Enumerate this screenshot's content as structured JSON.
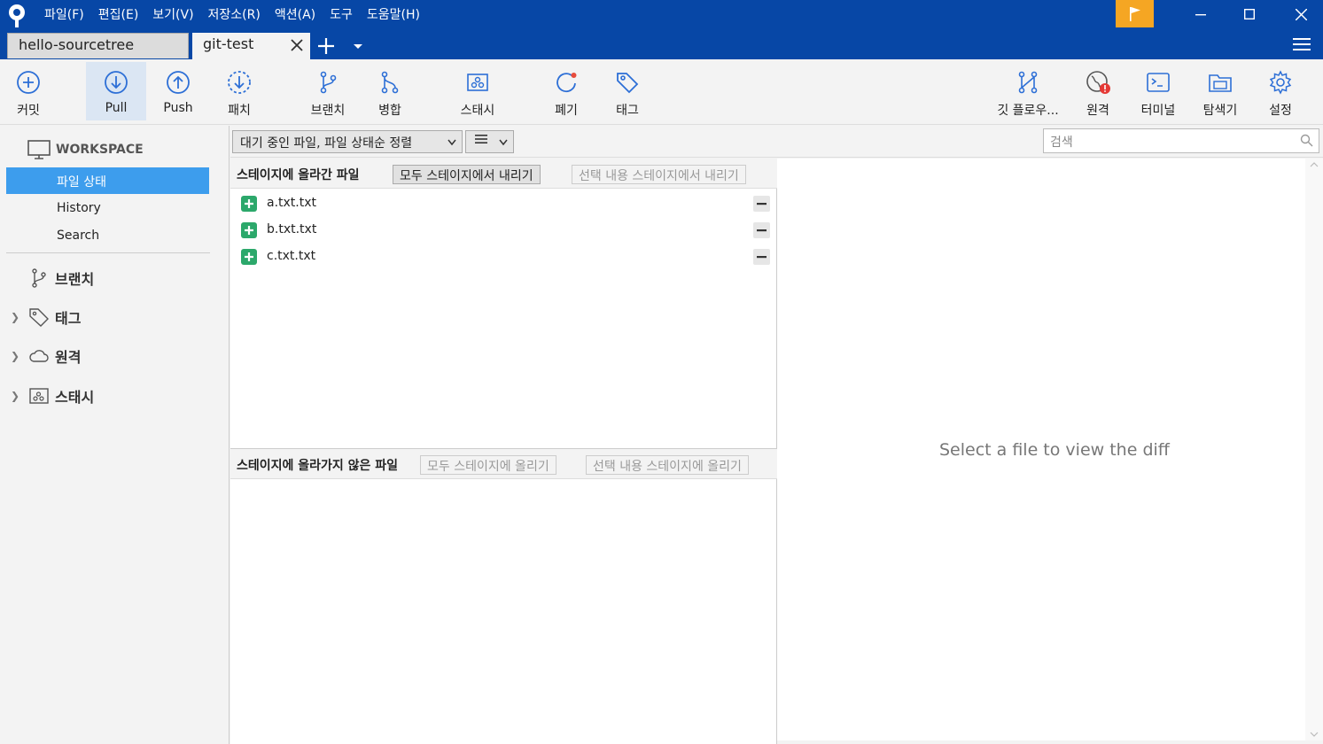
{
  "menu": [
    "파일(F)",
    "편집(E)",
    "보기(V)",
    "저장소(R)",
    "액션(A)",
    "도구",
    "도움말(H)"
  ],
  "tabs": [
    "hello-sourcetree",
    "git-test"
  ],
  "toolbar": {
    "commit": "커밋",
    "pull": "Pull",
    "push": "Push",
    "patch": "패치",
    "branch": "브랜치",
    "merge": "병합",
    "stash": "스태시",
    "discard": "폐기",
    "tag": "태그",
    "gitflow": "깃 플로우...",
    "remote": "원격",
    "terminal": "터미널",
    "explorer": "탐색기",
    "settings": "설정"
  },
  "sidebar": {
    "workspace": "WORKSPACE",
    "items": [
      "파일 상태",
      "History",
      "Search"
    ],
    "groups": [
      "브랜치",
      "태그",
      "원격",
      "스태시"
    ]
  },
  "filter": {
    "sort": "대기 중인 파일, 파일 상태순 정렬",
    "search_placeholder": "검색"
  },
  "staged": {
    "title": "스테이지에 올라간 파일",
    "unstage_all": "모두 스테이지에서 내리기",
    "unstage_sel": "선택 내용 스테이지에서 내리기",
    "files": [
      "a.txt.txt",
      "b.txt.txt",
      "c.txt.txt"
    ]
  },
  "unstaged": {
    "title": "스테이지에 올라가지 않은 파일",
    "stage_all": "모두 스테이지에 올리기",
    "stage_sel": "선택 내용 스테이지에 올리기"
  },
  "diff": {
    "message": "Select a file to view the diff"
  },
  "colors": {
    "titlebar": "#0747a6",
    "accent": "#3d9ded",
    "flag": "#f5a623",
    "added": "#2ca86b"
  }
}
